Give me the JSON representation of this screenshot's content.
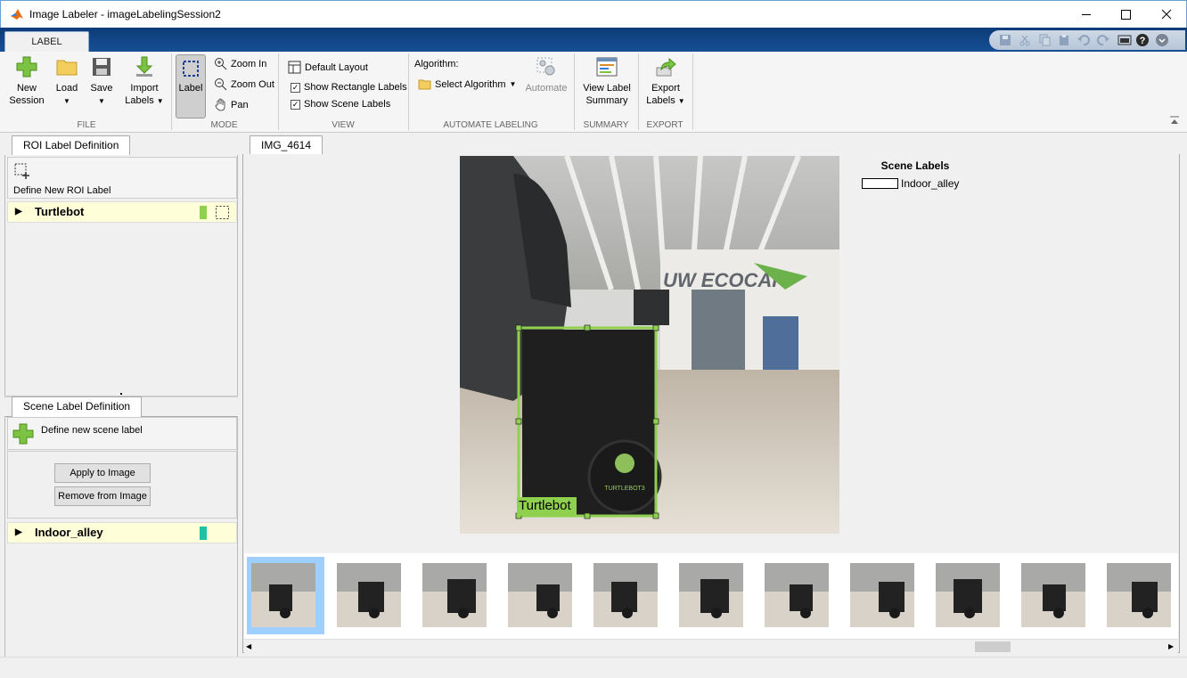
{
  "window": {
    "title": "Image Labeler - imageLabelingSession2"
  },
  "tabs": {
    "label": "LABEL"
  },
  "toolstrip": {
    "file": {
      "section": "FILE",
      "new_session": [
        "New",
        "Session"
      ],
      "load": "Load",
      "save": "Save",
      "import_labels": [
        "Import",
        "Labels"
      ]
    },
    "mode": {
      "section": "MODE",
      "label": "Label",
      "zoom_in": "Zoom In",
      "zoom_out": "Zoom Out",
      "pan": "Pan"
    },
    "view": {
      "section": "VIEW",
      "default_layout": "Default Layout",
      "show_rectangle_labels": "Show Rectangle Labels",
      "show_scene_labels": "Show Scene Labels",
      "show_rectangle_labels_checked": true,
      "show_scene_labels_checked": true
    },
    "automate": {
      "section": "AUTOMATE LABELING",
      "algorithm_label": "Algorithm:",
      "select_algorithm": "Select Algorithm",
      "automate": "Automate"
    },
    "summary": {
      "section": "SUMMARY",
      "view_label_summary": [
        "View Label",
        "Summary"
      ]
    },
    "export": {
      "section": "EXPORT",
      "export_labels": [
        "Export",
        "Labels"
      ]
    }
  },
  "roi_panel": {
    "tab": "ROI Label Definition",
    "define_new": "Define New ROI Label",
    "labels": [
      {
        "name": "Turtlebot",
        "color": "#8fd14f"
      }
    ]
  },
  "scene_panel": {
    "tab": "Scene Label Definition",
    "define_new": "Define new scene label",
    "apply": "Apply to Image",
    "remove": "Remove from Image",
    "labels": [
      {
        "name": "Indoor_alley",
        "color": "#21c1a4"
      }
    ]
  },
  "image": {
    "tab": "IMG_4614",
    "box_label": "Turtlebot",
    "box_color": "#8fd14f",
    "wall_text": "UW ECOCAR",
    "robot_text": "TURTLEBOT3"
  },
  "scene_labels": {
    "title": "Scene Labels",
    "items": [
      "Indoor_alley"
    ]
  },
  "filmstrip": {
    "count": 11,
    "selected_index": 0
  },
  "colors": {
    "title_accent": "#0c3c78",
    "selection": "#8fd14f",
    "thumb_selected": "#9ecfff"
  }
}
